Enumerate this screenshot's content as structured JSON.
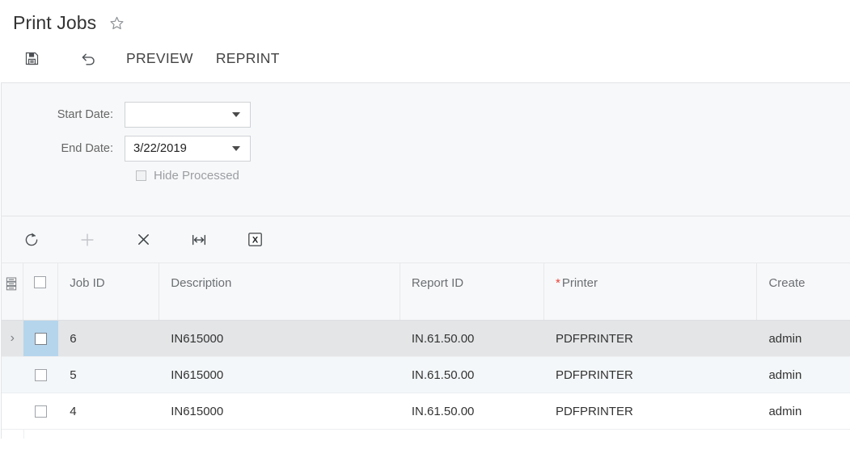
{
  "page": {
    "title": "Print Jobs",
    "favorite_icon": "star-outline-icon"
  },
  "form_toolbar": {
    "save_icon": "save-icon",
    "undo_icon": "undo-icon",
    "buttons": [
      {
        "label": "PREVIEW",
        "name": "preview"
      },
      {
        "label": "REPRINT",
        "name": "reprint"
      }
    ]
  },
  "filters": {
    "start_date": {
      "label": "Start Date:",
      "value": "",
      "placeholder": ""
    },
    "end_date": {
      "label": "End Date:",
      "value": "3/22/2019",
      "placeholder": ""
    },
    "hide_processed": {
      "label": "Hide Processed",
      "checked": false
    }
  },
  "grid_toolbar": {
    "buttons": [
      {
        "name": "refresh",
        "icon": "refresh-icon"
      },
      {
        "name": "add-row",
        "icon": "plus-icon"
      },
      {
        "name": "delete-row",
        "icon": "close-x-icon"
      },
      {
        "name": "fit-columns",
        "icon": "fit-width-icon"
      },
      {
        "name": "export-excel",
        "icon": "excel-export-icon"
      }
    ]
  },
  "grid": {
    "config_icon": "column-config-icon",
    "select_all": {
      "checked": false
    },
    "columns": [
      {
        "key": "job_id",
        "label": "Job ID",
        "required": false
      },
      {
        "key": "description",
        "label": "Description",
        "required": false
      },
      {
        "key": "report_id",
        "label": "Report ID",
        "required": false
      },
      {
        "key": "printer",
        "label": "Printer",
        "required": true
      },
      {
        "key": "created_by",
        "label": "Create",
        "required": false
      }
    ],
    "rows": [
      {
        "selected": true,
        "checked": false,
        "indicator": "›",
        "job_id": "6",
        "description": "IN615000",
        "report_id": "IN.61.50.00",
        "printer": "PDFPRINTER",
        "created_by": "admin"
      },
      {
        "selected": false,
        "checked": false,
        "indicator": "",
        "job_id": "5",
        "description": "IN615000",
        "report_id": "IN.61.50.00",
        "printer": "PDFPRINTER",
        "created_by": "admin"
      },
      {
        "selected": false,
        "checked": false,
        "indicator": "",
        "job_id": "4",
        "description": "IN615000",
        "report_id": "IN.61.50.00",
        "printer": "PDFPRINTER",
        "created_by": "admin"
      }
    ]
  },
  "colors": {
    "required_asterisk": "#e8443a",
    "selected_row": "#e3e5e7",
    "selected_checkbox_cell": "#b5d5ec",
    "alt_row": "#f4f7f9",
    "panel_bg": "#f7f8f9"
  }
}
